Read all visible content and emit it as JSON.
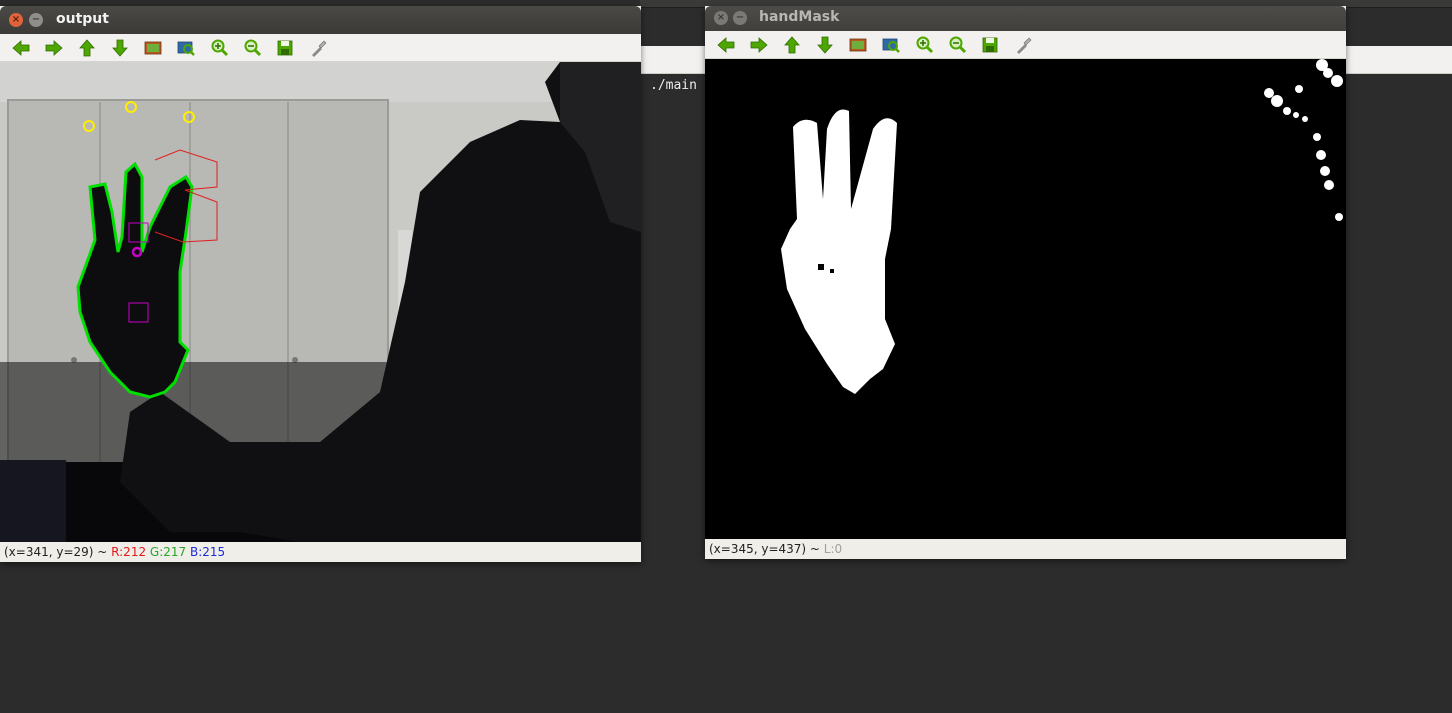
{
  "terminal": {
    "command": "./main"
  },
  "windows": {
    "output": {
      "title": "output",
      "status": {
        "coords": "(x=341, y=29) ~ ",
        "r": "R:212",
        "g": "G:217",
        "b": "B:215"
      }
    },
    "mask": {
      "title": "handMask",
      "status": {
        "coords": "(x=345, y=437) ~ ",
        "l": "L:0"
      }
    }
  },
  "toolbar": {
    "icons": [
      "arrow-left-icon",
      "arrow-right-icon",
      "arrow-up-icon",
      "arrow-down-icon",
      "image-icon",
      "zoom-fit-icon",
      "zoom-in-icon",
      "zoom-out-icon",
      "save-icon",
      "properties-icon"
    ]
  },
  "colors": {
    "contour": "#00e000",
    "fingertip": "#ffee00",
    "hull": "#e02020",
    "palm_box": "#c800c8",
    "icon_green": "#4ea600"
  }
}
